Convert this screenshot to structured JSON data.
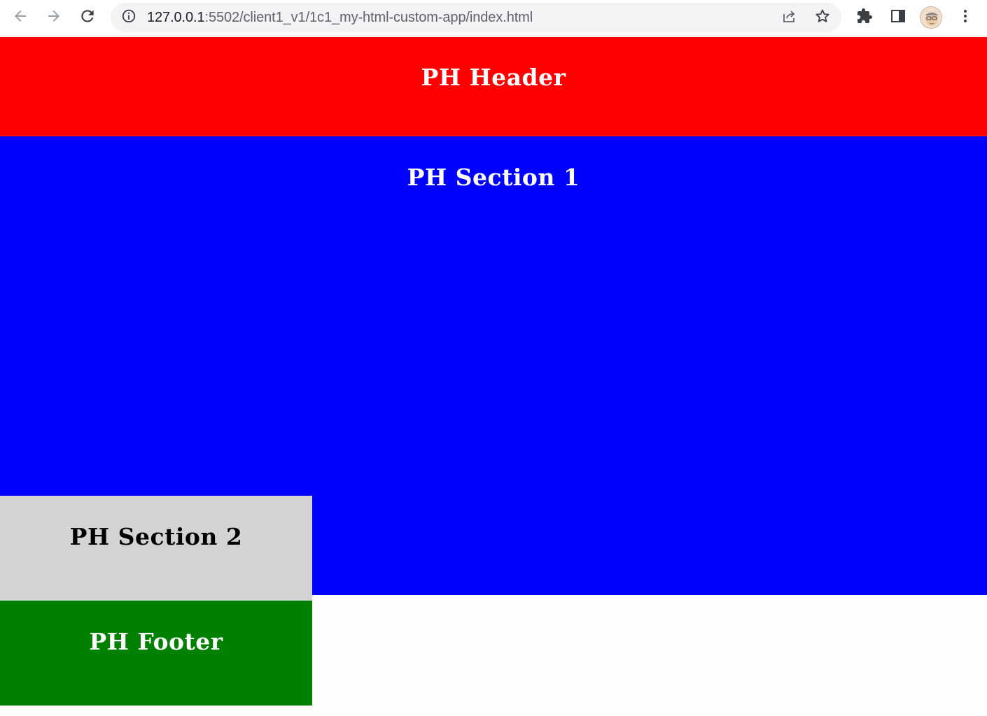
{
  "browser": {
    "url_host": "127.0.0.1",
    "url_path": ":5502/client1_v1/1c1_my-html-custom-app/index.html"
  },
  "icons": {
    "back": "arrow-left-icon",
    "forward": "arrow-right-icon",
    "reload": "reload-icon",
    "site_info": "info-icon",
    "share": "share-icon",
    "bookmark": "star-icon",
    "extensions": "puzzle-icon",
    "side_panel": "side-panel-icon",
    "profile": "avatar-icon",
    "menu": "kebab-menu-icon"
  },
  "page": {
    "header": {
      "title": "PH Header",
      "color": "#ff0000"
    },
    "section1": {
      "title": "PH Section 1",
      "color": "#0000ff"
    },
    "section2": {
      "title": "PH Section 2",
      "color": "#d3d3d3"
    },
    "footer": {
      "title": "PH Footer",
      "color": "#008000"
    }
  }
}
